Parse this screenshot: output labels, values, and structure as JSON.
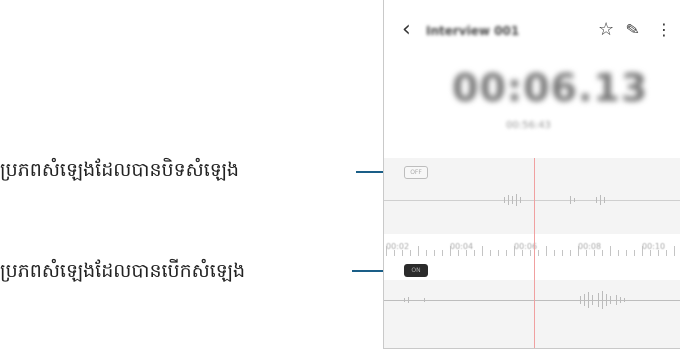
{
  "callouts": {
    "muted_track": "ប្រភពសំឡេងដែលបានបិទសំឡេង",
    "unmuted_track": "ប្រភពសំឡេងដែលបានបើកសំឡេង"
  },
  "header": {
    "title": "Interview 001"
  },
  "timer": {
    "value": "00:06.13",
    "sub": "00:56:43"
  },
  "timeline": {
    "ticks": [
      "00:02",
      "00:04",
      "00:06",
      "00:08",
      "00:10"
    ]
  },
  "tracks": {
    "muted_toggle_label": "OFF",
    "unmuted_toggle_label": "ON"
  },
  "colors": {
    "callout_line": "#1a5e87",
    "playhead": "#f0a0a0"
  },
  "icons": {
    "back": "chevron-left-icon",
    "bookmark": "star-icon",
    "edit": "pencil-icon",
    "more": "more-vertical-icon"
  }
}
